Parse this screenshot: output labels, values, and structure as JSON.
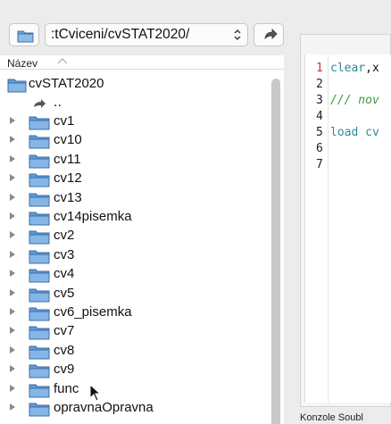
{
  "toolbar": {
    "path_value": ":tCviceni/cvSTAT2020/",
    "path_chevron": "⌃⌄"
  },
  "browser": {
    "column_label": "Název",
    "root_folder": "cvSTAT2020",
    "parent_label": "..",
    "folders": [
      "cv1",
      "cv10",
      "cv11",
      "cv12",
      "cv13",
      "cv14pisemka",
      "cv2",
      "cv3",
      "cv4",
      "cv5",
      "cv6_pisemka",
      "cv7",
      "cv8",
      "cv9",
      "func",
      "opravnaOpravna"
    ]
  },
  "editor": {
    "line_numbers": [
      "1",
      "2",
      "3",
      "4",
      "5",
      "6",
      "7"
    ],
    "lines": {
      "l1_kw": "clear",
      "l1_rest": ",x",
      "l3_comment": "/// nov",
      "l5_kw": "load",
      "l5_rest": " cv"
    }
  },
  "status": {
    "text": "Konzole Soubl"
  }
}
